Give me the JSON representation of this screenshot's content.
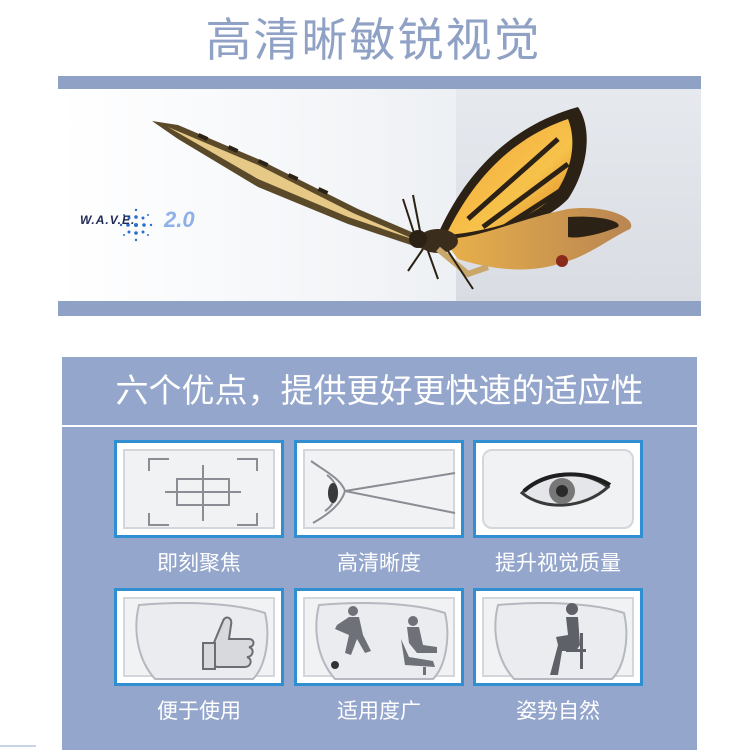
{
  "header": {
    "title": "高清晰敏锐视觉"
  },
  "banner": {
    "logo_text": "W.A.V.E.",
    "logo_version": "2.0"
  },
  "panel": {
    "title": "六个优点，提供更好更快速的适应性",
    "features": [
      {
        "label": "即刻聚焦",
        "icon": "focus-reticle-icon"
      },
      {
        "label": "高清晰度",
        "icon": "eye-profile-icon"
      },
      {
        "label": "提升视觉质量",
        "icon": "eye-icon"
      },
      {
        "label": "便于使用",
        "icon": "thumbs-up-icon"
      },
      {
        "label": "适用度广",
        "icon": "sports-and-desk-icon"
      },
      {
        "label": "姿势自然",
        "icon": "seated-person-icon"
      }
    ]
  },
  "colors": {
    "accent": "#8fa1c4",
    "tile_border": "#2f8fd0",
    "panel_bg": "#94a6cc"
  }
}
